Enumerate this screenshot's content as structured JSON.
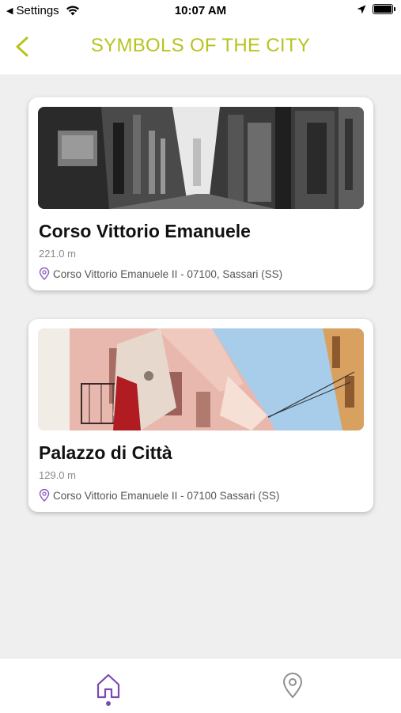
{
  "status_bar": {
    "back_app": "Settings",
    "time": "10:07 AM"
  },
  "header": {
    "title": "SYMBOLS OF THE CITY",
    "back_icon": "chevron-left-icon",
    "accent_color": "#b8c31f"
  },
  "places": [
    {
      "name": "Corso Vittorio Emanuele",
      "distance": "221.0 m",
      "address": "Corso Vittorio Emanuele II - 07100, Sassari (SS)"
    },
    {
      "name": "Palazzo di Città",
      "distance": "129.0 m",
      "address": "Corso Vittorio Emanuele II - 07100 Sassari (SS)"
    }
  ],
  "tab_bar": {
    "tabs": [
      {
        "icon": "home-icon",
        "active": true
      },
      {
        "icon": "map-pin-icon",
        "active": false
      }
    ],
    "active_color": "#7b4ab0"
  }
}
